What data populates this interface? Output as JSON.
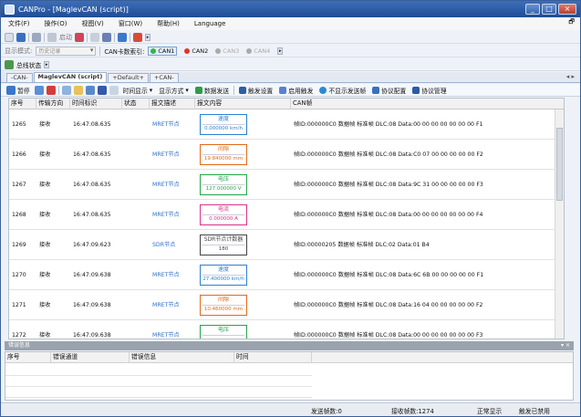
{
  "window": {
    "title": "CANPro - [MaglevCAN (script)]",
    "min": "_",
    "max": "□",
    "close": "×"
  },
  "menu": [
    "文件(F)",
    "操作(O)",
    "视图(V)",
    "窗口(W)",
    "帮助(H)",
    "Language"
  ],
  "toolbar1": {
    "start_label": "启动"
  },
  "toolbar2": {
    "display_mode_label": "显示模式:",
    "display_mode_value": "历史记录",
    "can_index_label": "CAN卡数索引:",
    "channels": [
      {
        "label": "CAN1",
        "color": "#2fb54a",
        "state": "active"
      },
      {
        "label": "CAN2",
        "color": "#e0342c",
        "state": "normal"
      },
      {
        "label": "CAN3",
        "color": "#aaaaaa",
        "state": "disabled"
      },
      {
        "label": "CAN4",
        "color": "#aaaaaa",
        "state": "disabled"
      }
    ]
  },
  "toolbar3": {
    "bus_status_label": "总线状态"
  },
  "tabs": [
    "-CAN-",
    "MaglevCAN (script)",
    "+Default+",
    "+CAN-"
  ],
  "toolbar4": {
    "pause": "暂停",
    "time_display": "时间显示",
    "display_mode": "显示方式",
    "data_send": "数据发送",
    "trigger_settings": "触发设置",
    "enable_trigger": "启用触发",
    "hide_send_frames": "不显示发送帧",
    "protocol_config": "协议配置",
    "protocol_manage": "协议管理"
  },
  "table": {
    "headers": [
      "序号",
      "传输方向",
      "时间标识",
      "状态",
      "报文描述",
      "报文内容",
      "CAN帧"
    ],
    "rows": [
      {
        "seq": "1265",
        "dir": "接收",
        "time": "16:47:08.635",
        "status": "",
        "desc": "MRET节点",
        "sig_name": "速度",
        "sig_value": "0.000000 km/h",
        "sig_color": "#2e7fd1",
        "frame": "帧ID:000000C0 数据帧 标准帧 DLC:08 Data:00 00 00 00 00 00 00 F1"
      },
      {
        "seq": "1266",
        "dir": "接收",
        "time": "16:47:08.635",
        "status": "",
        "desc": "MRET节点",
        "sig_name": "间隙",
        "sig_value": "19.840000 mm",
        "sig_color": "#e06a1a",
        "frame": "帧ID:000000C0 数据帧 标准帧 DLC:08 Data:C0 07 00 00 00 00 00 F2"
      },
      {
        "seq": "1267",
        "dir": "接收",
        "time": "16:47:08.635",
        "status": "",
        "desc": "MRET节点",
        "sig_name": "电压",
        "sig_value": "127.000000 V",
        "sig_color": "#26a34a",
        "frame": "帧ID:000000C0 数据帧 标准帧 DLC:08 Data:9C 31 00 00 00 00 00 F3"
      },
      {
        "seq": "1268",
        "dir": "接收",
        "time": "16:47:08.635",
        "status": "",
        "desc": "MRET节点",
        "sig_name": "电流",
        "sig_value": "0.000000 A",
        "sig_color": "#d8338a",
        "frame": "帧ID:000000C0 数据帧 标准帧 DLC:08 Data:00 00 00 00 00 00 00 F4"
      },
      {
        "seq": "1269",
        "dir": "接收",
        "time": "16:47:09.623",
        "status": "",
        "desc": "SDR节点",
        "sig_name": "SDR节点计数器",
        "sig_value": "180",
        "sig_color": "#444444",
        "frame": "帧ID:00000205 数据帧 标准帧 DLC:02 Data:01 B4"
      },
      {
        "seq": "1270",
        "dir": "接收",
        "time": "16:47:09.638",
        "status": "",
        "desc": "MRET节点",
        "sig_name": "速度",
        "sig_value": "27.400000 km/h",
        "sig_color": "#2e7fd1",
        "frame": "帧ID:000000C0 数据帧 标准帧 DLC:08 Data:6C 6B 00 00 00 00 00 F1"
      },
      {
        "seq": "1271",
        "dir": "接收",
        "time": "16:47:09.638",
        "status": "",
        "desc": "MRET节点",
        "sig_name": "间隙",
        "sig_value": "10.460000 mm",
        "sig_color": "#e06a1a",
        "frame": "帧ID:000000C0 数据帧 标准帧 DLC:08 Data:16 04 00 00 00 00 00 F2"
      },
      {
        "seq": "1272",
        "dir": "接收",
        "time": "16:47:09.638",
        "status": "",
        "desc": "MRET节点",
        "sig_name": "电压",
        "sig_value": "",
        "sig_color": "#26a34a",
        "frame": "帧ID:000000C0 数据帧 标准帧 DLC:08 Data:00 00 00 00 00 00 00 F3"
      }
    ]
  },
  "error_panel": {
    "title": "错误信息",
    "headers": [
      "序号",
      "错误通道",
      "错误信息",
      "时间"
    ]
  },
  "statusbar": {
    "send_count": "发送帧数:0",
    "recv_count": "接收帧数:1274",
    "display_state": "正常显示",
    "trigger_state": "触发已禁用"
  }
}
